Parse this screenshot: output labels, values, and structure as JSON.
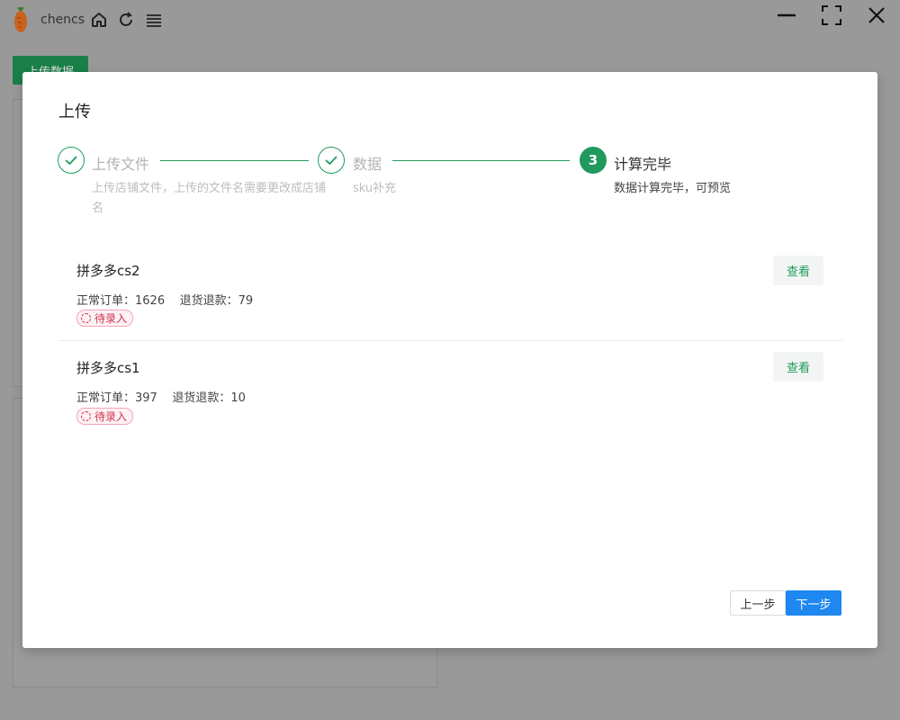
{
  "app": {
    "name": "chencs",
    "logo_icon": "carrot-icon",
    "toolbar_icons": [
      "home-icon",
      "refresh-icon",
      "menu-icon"
    ],
    "window_controls": [
      "minimize-icon",
      "maximize-icon",
      "close-icon"
    ]
  },
  "background": {
    "upload_button_label": "上传数据"
  },
  "modal": {
    "title": "上传",
    "steps": [
      {
        "number": "1",
        "title": "上传文件",
        "description": "上传店铺文件，上传的文件名需要更改成店铺名",
        "status": "done"
      },
      {
        "number": "2",
        "title": "数据",
        "description": "sku补充",
        "status": "done"
      },
      {
        "number": "3",
        "title": "计算完毕",
        "description": "数据计算完毕，可预览",
        "status": "active"
      }
    ],
    "items": [
      {
        "shop": "拼多多cs2",
        "normal_orders_label": "正常订单：",
        "normal_orders": "1626",
        "refund_label": "退货退款：",
        "refund": "79",
        "status": "待录入",
        "action": "查看"
      },
      {
        "shop": "拼多多cs1",
        "normal_orders_label": "正常订单：",
        "normal_orders": "397",
        "refund_label": "退货退款：",
        "refund": "10",
        "status": "待录入",
        "action": "查看"
      }
    ],
    "footer": {
      "prev_label": "上一步",
      "next_label": "下一步"
    }
  },
  "colors": {
    "primary_green": "#1f9a5c",
    "primary_blue": "#1e88f0",
    "badge_red": "#d0344f",
    "overlay": "#999999"
  }
}
